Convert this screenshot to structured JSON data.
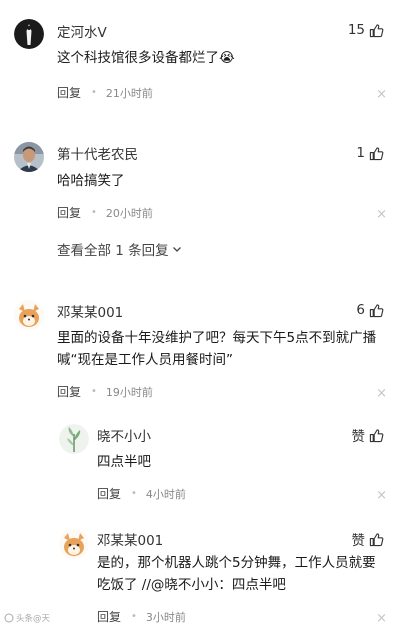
{
  "comments": [
    {
      "username": "定河水V",
      "likes": "15",
      "text": "这个科技馆很多设备都烂了",
      "emoji": "😭",
      "reply_label": "回复",
      "time": "21小时前"
    },
    {
      "username": "第十代老农民",
      "likes": "1",
      "text": "哈哈搞笑了",
      "reply_label": "回复",
      "time": "20小时前",
      "expand_label": "查看全部 1 条回复"
    },
    {
      "username": "邓某某001",
      "likes": "6",
      "text_line1": "里面的设备十年没维护了吧？每天下午5点不到就广播",
      "text_line2": "喊“现在是工作人员用餐时间”",
      "reply_label": "回复",
      "time": "19小时前",
      "replies": [
        {
          "username": "晓不小小",
          "likes": "赞",
          "text": "四点半吧",
          "reply_label": "回复",
          "time": "4小时前"
        },
        {
          "username": "邓某某001",
          "likes": "赞",
          "text_line1": "是的，那个机器人跳个5分钟舞，工作人员就要",
          "text_line2": "吃饭了 //@晓不小小：四点半吧",
          "reply_label": "回复",
          "time": "3小时前"
        }
      ]
    }
  ],
  "watermark": "头条@天",
  "close_glyph": "×",
  "dot_glyph": "•",
  "icons": {
    "like": "thumbs-up-icon",
    "close": "close-icon",
    "expand": "chevron-down-icon"
  },
  "colors": {
    "text_primary": "#1a1a1a",
    "text_secondary": "#888888",
    "close": "#c4c4c4"
  }
}
